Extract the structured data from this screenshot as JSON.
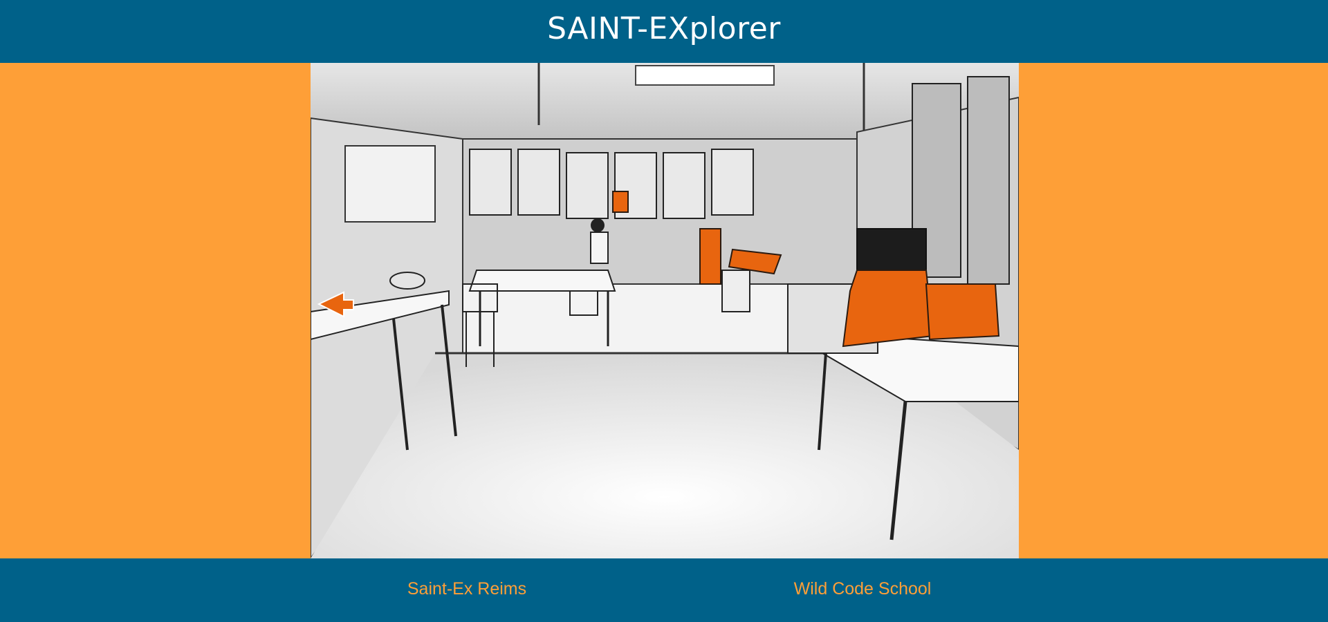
{
  "header": {
    "title": "SAINT-EXplorer"
  },
  "footer": {
    "links": [
      {
        "label": "Saint-Ex Reims"
      },
      {
        "label": "Wild Code School"
      }
    ]
  },
  "colors": {
    "header_bg": "#006189",
    "side_bg": "#fe9f37",
    "accent": "#fe9f37",
    "highlight": "#e8650f"
  },
  "scene": {
    "description_icons": [
      "nav-arrow-left-icon"
    ],
    "hotspots": [
      "hotspot-sewing-machines",
      "hotspot-orange-cabinet",
      "hotspot-orange-shelf-item",
      "hotspot-window-object"
    ]
  }
}
